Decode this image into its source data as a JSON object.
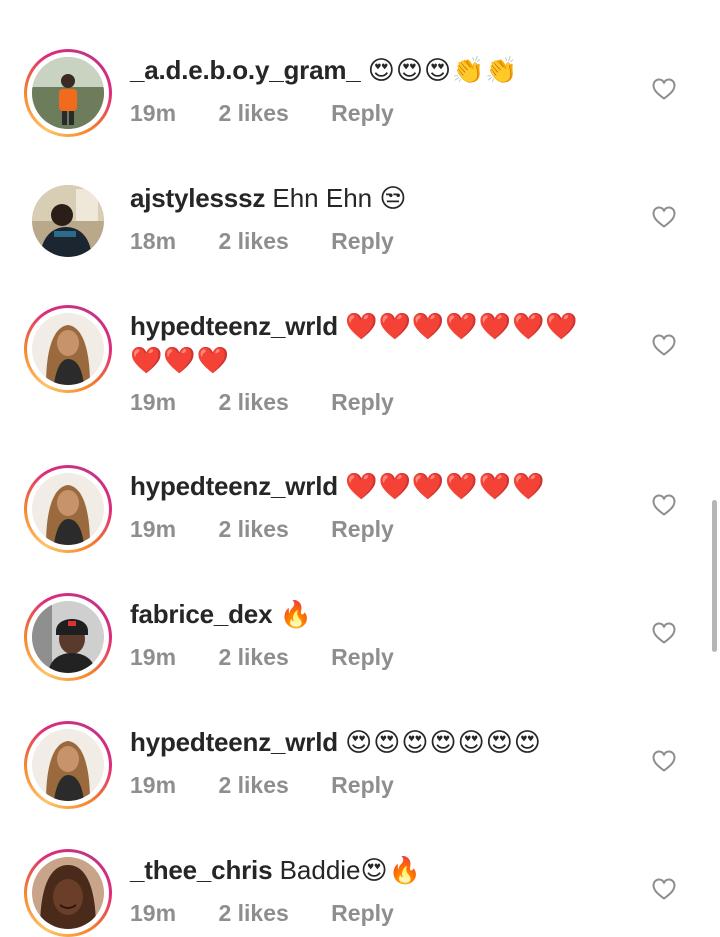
{
  "comments": [
    {
      "username": "_a.d.e.b.o.y_gram_",
      "text": "",
      "emojis": "😍😍😍👏👏",
      "time": "19m",
      "likes": "2 likes",
      "reply": "Reply",
      "avatar": "person-orange-shirt"
    },
    {
      "username": "ajstylesssz",
      "text": "Ehn Ehn",
      "emojis": "😒",
      "time": "18m",
      "likes": "2 likes",
      "reply": "Reply",
      "avatar": "person-dark-hoodie"
    },
    {
      "username": "hypedteenz_wrld",
      "text": "",
      "emojis": "❤️❤️❤️❤️❤️❤️❤️❤️❤️❤️",
      "time": "19m",
      "likes": "2 likes",
      "reply": "Reply",
      "avatar": "woman-portrait"
    },
    {
      "username": "hypedteenz_wrld",
      "text": "",
      "emojis": "❤️❤️❤️❤️❤️❤️",
      "time": "19m",
      "likes": "2 likes",
      "reply": "Reply",
      "avatar": "woman-portrait"
    },
    {
      "username": "fabrice_dex",
      "text": "",
      "emojis": "🔥",
      "time": "19m",
      "likes": "2 likes",
      "reply": "Reply",
      "avatar": "man-beanie"
    },
    {
      "username": "hypedteenz_wrld",
      "text": "",
      "emojis": "😍😍😍😍😍😍😍",
      "time": "19m",
      "likes": "2 likes",
      "reply": "Reply",
      "avatar": "woman-portrait"
    },
    {
      "username": "_thee_chris",
      "text": "Baddie",
      "emojis": "😍🔥",
      "time": "19m",
      "likes": "2 likes",
      "reply": "Reply",
      "avatar": "woman-braids"
    }
  ],
  "icons": {
    "like": "heart-outline-icon"
  },
  "colors": {
    "meta_text": "#8e8e8e",
    "username_text": "#262626",
    "ring_gradient": [
      "#fdc468",
      "#f58529",
      "#dd2a7b",
      "#c13584"
    ]
  }
}
